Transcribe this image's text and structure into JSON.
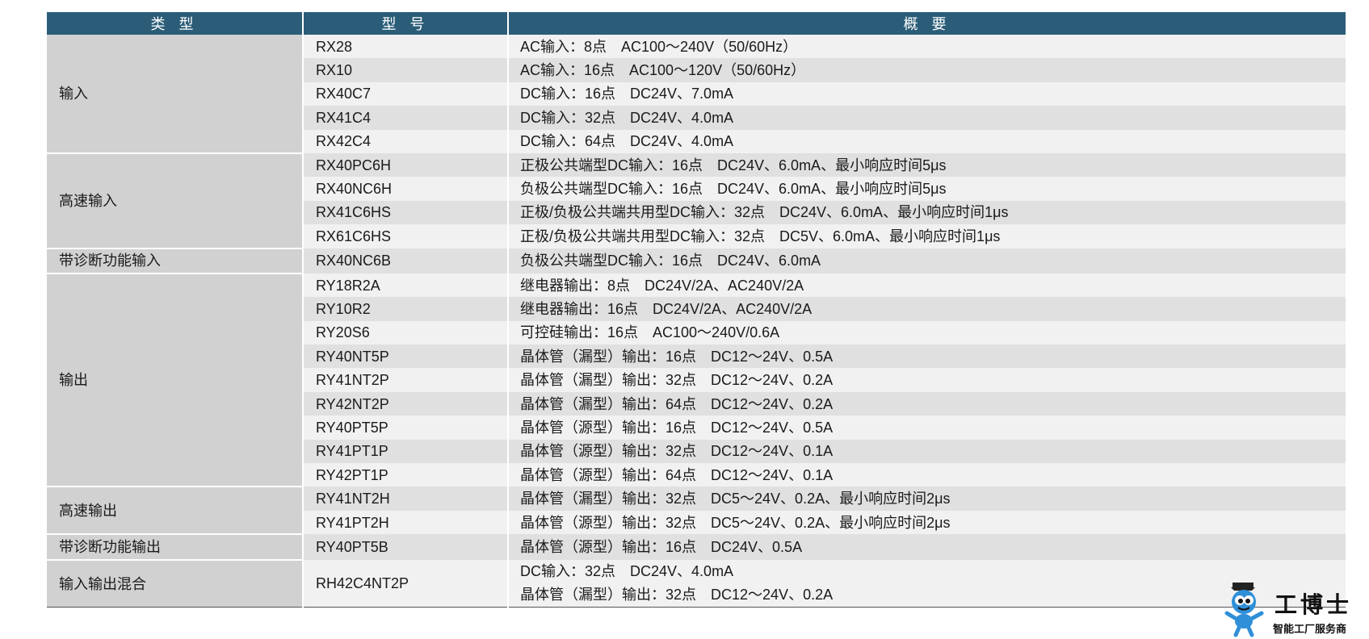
{
  "headers": [
    "类 型",
    "型 号",
    "概 要"
  ],
  "groups": [
    {
      "category": "输入",
      "rows": [
        {
          "model": "RX28",
          "desc": "AC输入：8点　AC100～240V（50/60Hz）"
        },
        {
          "model": "RX10",
          "desc": "AC输入：16点　AC100～120V（50/60Hz）"
        },
        {
          "model": "RX40C7",
          "desc": "DC输入：16点　DC24V、7.0mA"
        },
        {
          "model": "RX41C4",
          "desc": "DC输入：32点　DC24V、4.0mA"
        },
        {
          "model": "RX42C4",
          "desc": "DC输入：64点　DC24V、4.0mA"
        }
      ]
    },
    {
      "category": "高速输入",
      "rows": [
        {
          "model": "RX40PC6H",
          "desc": "正极公共端型DC输入：16点　DC24V、6.0mA、最小响应时间5μs"
        },
        {
          "model": "RX40NC6H",
          "desc": "负极公共端型DC输入：16点　DC24V、6.0mA、最小响应时间5μs"
        },
        {
          "model": "RX41C6HS",
          "desc": "正极/负极公共端共用型DC输入：32点　DC24V、6.0mA、最小响应时间1μs"
        },
        {
          "model": "RX61C6HS",
          "desc": "正极/负极公共端共用型DC输入：32点　DC5V、6.0mA、最小响应时间1μs"
        }
      ]
    },
    {
      "category": "带诊断功能输入",
      "rows": [
        {
          "model": "RX40NC6B",
          "desc": "负极公共端型DC输入：16点　DC24V、6.0mA"
        }
      ]
    },
    {
      "category": "输出",
      "rows": [
        {
          "model": "RY18R2A",
          "desc": "继电器输出：8点　DC24V/2A、AC240V/2A"
        },
        {
          "model": "RY10R2",
          "desc": "继电器输出：16点　DC24V/2A、AC240V/2A"
        },
        {
          "model": "RY20S6",
          "desc": "可控硅输出：16点　AC100～240V/0.6A"
        },
        {
          "model": "RY40NT5P",
          "desc": "晶体管（漏型）输出：16点　DC12～24V、0.5A"
        },
        {
          "model": "RY41NT2P",
          "desc": "晶体管（漏型）输出：32点　DC12～24V、0.2A"
        },
        {
          "model": "RY42NT2P",
          "desc": "晶体管（漏型）输出：64点　DC12～24V、0.2A"
        },
        {
          "model": "RY40PT5P",
          "desc": "晶体管（源型）输出：16点　DC12～24V、0.5A"
        },
        {
          "model": "RY41PT1P",
          "desc": "晶体管（源型）输出：32点　DC12～24V、0.1A"
        },
        {
          "model": "RY42PT1P",
          "desc": "晶体管（源型）输出：64点　DC12～24V、0.1A"
        }
      ]
    },
    {
      "category": "高速输出",
      "rows": [
        {
          "model": "RY41NT2H",
          "desc": "晶体管（漏型）输出：32点　DC5～24V、0.2A、最小响应时间2μs"
        },
        {
          "model": "RY41PT2H",
          "desc": "晶体管（源型）输出：32点　DC5～24V、0.2A、最小响应时间2μs"
        }
      ]
    },
    {
      "category": "带诊断功能输出",
      "rows": [
        {
          "model": "RY40PT5B",
          "desc": "晶体管（源型）输出：16点　DC24V、0.5A"
        }
      ]
    },
    {
      "category": "输入输出混合",
      "rows": [
        {
          "model": "RH42C4NT2P",
          "desc": [
            "DC输入：32点　DC24V、4.0mA",
            "晶体管（漏型）输出：32点　DC12～24V、0.2A"
          ]
        }
      ]
    }
  ],
  "logo": {
    "brand": "工博士",
    "tagline": "智能工厂服务商",
    "icon": "robot-mascot-icon"
  },
  "colors": {
    "header_bg": "#2b5d78",
    "category_bg": "#d1d1d1",
    "row_light": "#f1f1f1",
    "row_dark": "#e0e0e0"
  }
}
